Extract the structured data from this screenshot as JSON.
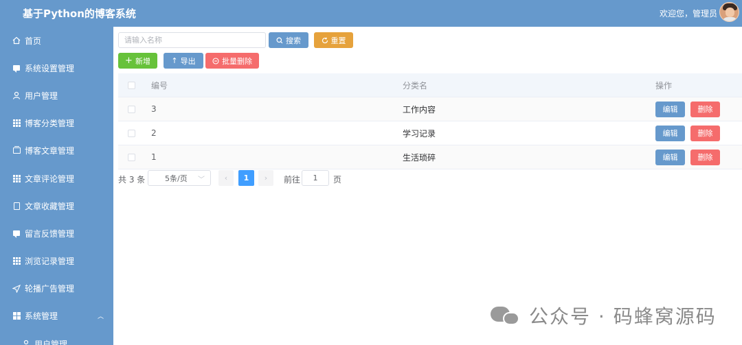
{
  "app": {
    "title": "基于Python的博客系统",
    "welcome": "欢迎您，管理员"
  },
  "sidebar": {
    "items": [
      {
        "label": "首页",
        "icon": "home-icon"
      },
      {
        "label": "系统设置管理",
        "icon": "chat-icon"
      },
      {
        "label": "用户管理",
        "icon": "user-icon"
      },
      {
        "label": "博客分类管理",
        "icon": "grid-icon"
      },
      {
        "label": "博客文章管理",
        "icon": "box-icon"
      },
      {
        "label": "文章评论管理",
        "icon": "grid-icon"
      },
      {
        "label": "文章收藏管理",
        "icon": "doc-icon"
      },
      {
        "label": "留言反馈管理",
        "icon": "chat-icon"
      },
      {
        "label": "浏览记录管理",
        "icon": "grid-icon"
      },
      {
        "label": "轮播广告管理",
        "icon": "send-icon"
      },
      {
        "label": "系统管理",
        "icon": "apps-icon"
      }
    ],
    "submenu": [
      {
        "label": "用户管理",
        "icon": "user-icon"
      }
    ]
  },
  "toolbar": {
    "search_placeholder": "请输入名称",
    "search_label": "搜索",
    "reset_label": "重置",
    "add_label": "新增",
    "export_label": "导出",
    "batch_delete_label": "批量删除"
  },
  "table": {
    "headers": [
      "编号",
      "分类名",
      "操作"
    ],
    "rows": [
      {
        "id": "3",
        "name": "工作内容"
      },
      {
        "id": "2",
        "name": "学习记录"
      },
      {
        "id": "1",
        "name": "生活琐碎"
      }
    ],
    "edit_label": "编辑",
    "delete_label": "删除"
  },
  "pagination": {
    "total": "共 3 条",
    "page_size": "5条/页",
    "current_page": "1",
    "goto_label": "前往",
    "goto_value": "1",
    "goto_unit": "页"
  },
  "watermark": {
    "text": "公众号 · 码蜂窝源码"
  },
  "colors": {
    "primary": "#6699cc",
    "warning": "#e6a23c",
    "success": "#67c23a",
    "danger": "#f56c6c",
    "active_page": "#409eff"
  }
}
